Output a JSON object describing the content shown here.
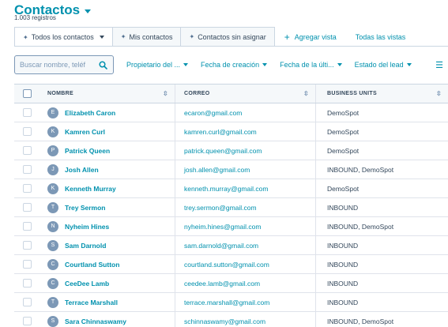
{
  "header": {
    "title": "Contactos",
    "record_count": "1.003 registros"
  },
  "tabs": [
    {
      "label": "Todos los contactos",
      "active": true,
      "pinned": true
    },
    {
      "label": "Mis contactos",
      "active": false,
      "pinned": true
    },
    {
      "label": "Contactos sin asignar",
      "active": false,
      "pinned": true
    }
  ],
  "tab_actions": {
    "add_view": "Agregar vista",
    "all_views": "Todas las vistas"
  },
  "filters": {
    "search_placeholder": "Buscar nombre, teléf",
    "items": [
      "Propietario del ...",
      "Fecha de creación",
      "Fecha de la últi...",
      "Estado del lead"
    ]
  },
  "table": {
    "columns": [
      "NOMBRE",
      "CORREO",
      "BUSINESS UNITS"
    ],
    "rows": [
      {
        "initial": "E",
        "name": "Elizabeth Caron",
        "email": "ecaron@gmail.com",
        "bu": "DemoSpot"
      },
      {
        "initial": "K",
        "name": "Kamren Curl",
        "email": "kamren.curl@gmail.com",
        "bu": "DemoSpot"
      },
      {
        "initial": "P",
        "name": "Patrick Queen",
        "email": "patrick.queen@gmail.com",
        "bu": "DemoSpot"
      },
      {
        "initial": "J",
        "name": "Josh Allen",
        "email": "josh.allen@gmail.com",
        "bu": "INBOUND, DemoSpot"
      },
      {
        "initial": "K",
        "name": "Kenneth Murray",
        "email": "kenneth.murray@gmail.com",
        "bu": "DemoSpot"
      },
      {
        "initial": "T",
        "name": "Trey Sermon",
        "email": "trey.sermon@gmail.com",
        "bu": "INBOUND"
      },
      {
        "initial": "N",
        "name": "Nyheim Hines",
        "email": "nyheim.hines@gmail.com",
        "bu": "INBOUND, DemoSpot"
      },
      {
        "initial": "S",
        "name": "Sam Darnold",
        "email": "sam.darnold@gmail.com",
        "bu": "INBOUND"
      },
      {
        "initial": "C",
        "name": "Courtland Sutton",
        "email": "courtland.sutton@gmail.com",
        "bu": "INBOUND"
      },
      {
        "initial": "C",
        "name": "CeeDee Lamb",
        "email": "ceedee.lamb@gmail.com",
        "bu": "INBOUND"
      },
      {
        "initial": "T",
        "name": "Terrace Marshall",
        "email": "terrace.marshall@gmail.com",
        "bu": "INBOUND"
      },
      {
        "initial": "S",
        "name": "Sara Chinnaswamy",
        "email": "schinnaswamy@gmail.com",
        "bu": "INBOUND, DemoSpot"
      }
    ]
  },
  "colors": {
    "accent": "#0091ae",
    "text": "#33475b",
    "border": "#cbd6e2",
    "avatar": "#7c98b6"
  },
  "icons": {
    "search": "search-icon",
    "pin": "pin-icon",
    "sort": "sort-icon",
    "settings": "settings-icon"
  }
}
